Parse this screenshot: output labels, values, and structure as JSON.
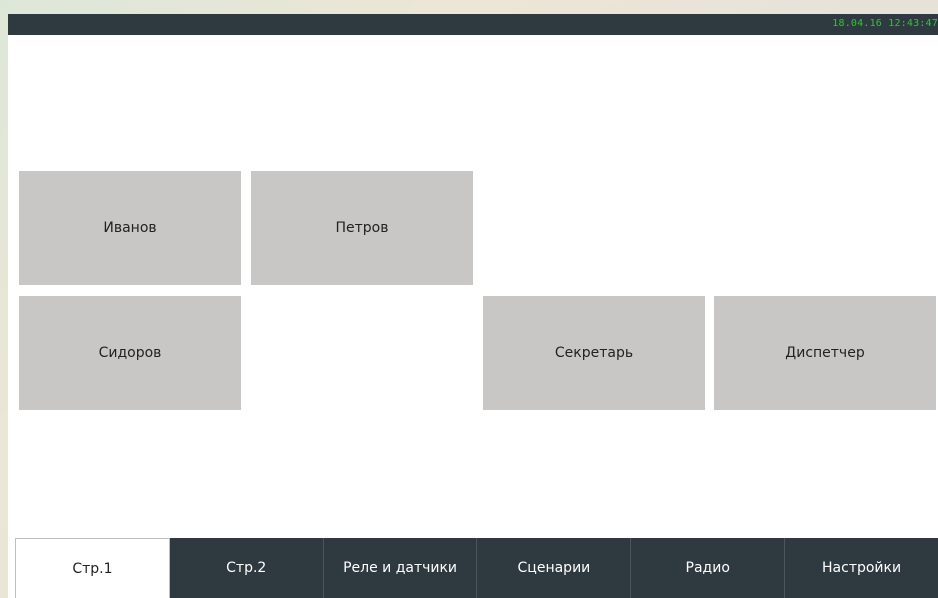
{
  "status_bar": {
    "datetime": "18.04.16 12:43:47"
  },
  "tiles": {
    "ivanov": "Иванов",
    "petrov": "Петров",
    "sidorov": "Сидоров",
    "sekretar": "Секретарь",
    "dispetcher": "Диспетчер"
  },
  "tabs": [
    {
      "label": "Стр.1",
      "active": true
    },
    {
      "label": "Стр.2",
      "active": false
    },
    {
      "label": "Реле и датчики",
      "active": false
    },
    {
      "label": "Сценарии",
      "active": false
    },
    {
      "label": "Радио",
      "active": false
    },
    {
      "label": "Настройки",
      "active": false
    }
  ],
  "colors": {
    "status_bar_bg": "#2e3a40",
    "clock_text": "#2fc62f",
    "tile_bg": "#c8c7c6",
    "tab_bg": "#2e3a40",
    "active_tab_bg": "#ffffff"
  }
}
